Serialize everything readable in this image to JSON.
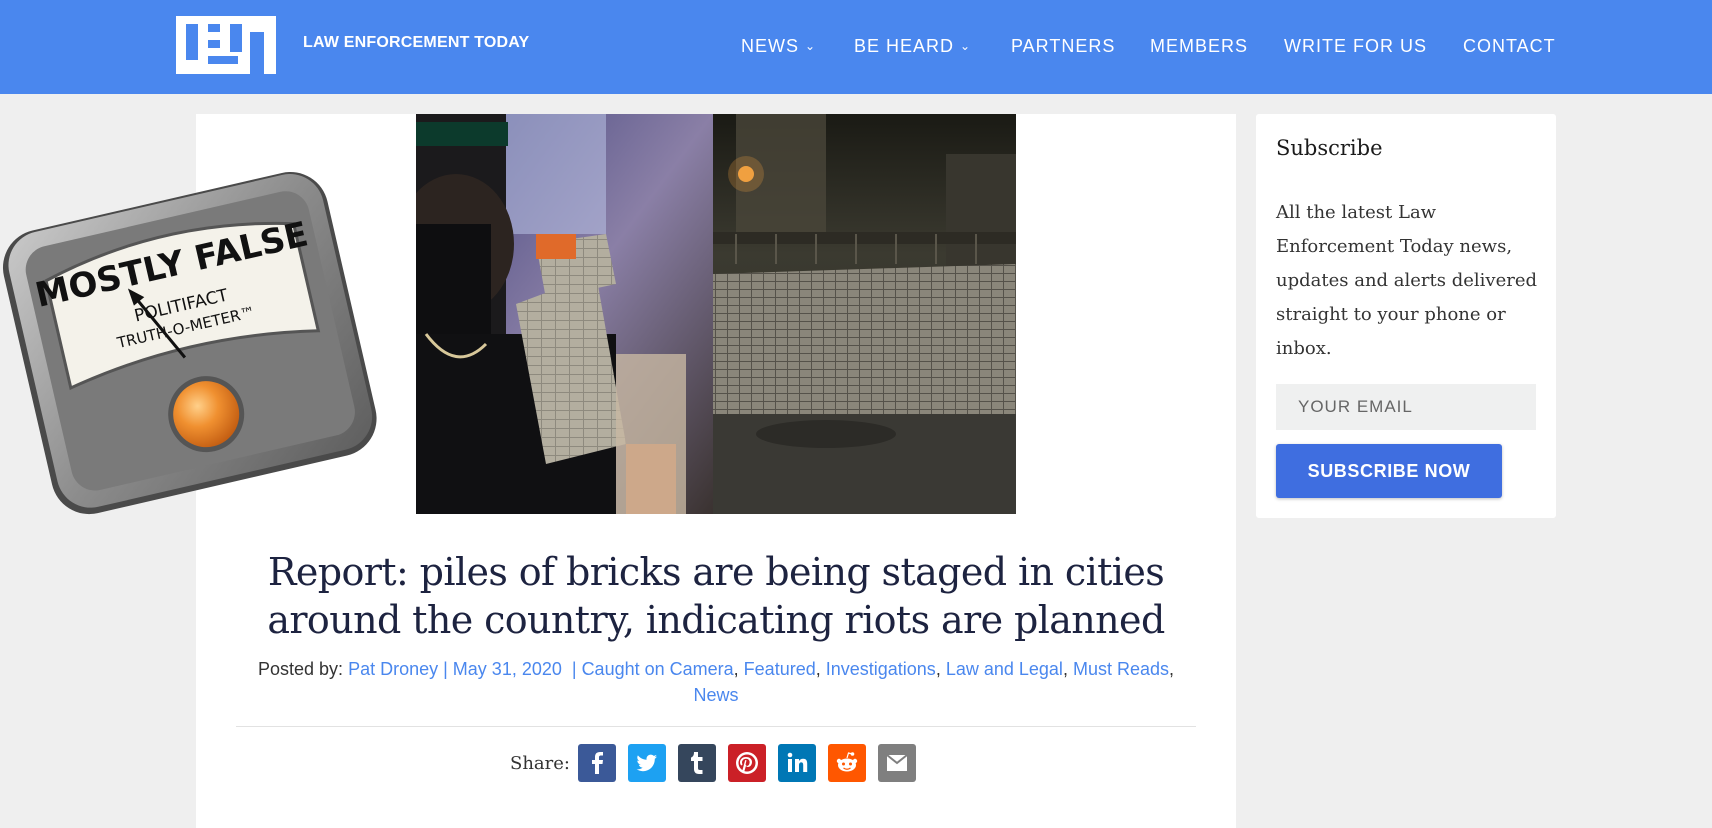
{
  "header": {
    "site_name": "LAW ENFORCEMENT TODAY",
    "logo_icon": "let-logo",
    "nav": [
      {
        "label": "NEWS",
        "has_dropdown": true
      },
      {
        "label": "BE HEARD",
        "has_dropdown": true
      },
      {
        "label": "PARTNERS",
        "has_dropdown": false
      },
      {
        "label": "MEMBERS",
        "has_dropdown": false
      },
      {
        "label": "WRITE FOR US",
        "has_dropdown": false
      },
      {
        "label": "CONTACT",
        "has_dropdown": false
      }
    ]
  },
  "rating": {
    "verdict": "MOSTLY FALSE",
    "brand_line1": "POLITIFACT",
    "brand_line2": "TRUTH-O-METER™"
  },
  "article": {
    "title": "Report: piles of bricks are being staged in cities around the country, indicating riots are planned",
    "posted_by_label": "Posted by:",
    "author": "Pat Droney",
    "date": "May 31, 2020",
    "categories": [
      "Caught on Camera",
      "Featured",
      "Investigations",
      "Law and Legal",
      "Must Reads",
      "News"
    ],
    "share_label": "Share:",
    "share_buttons": [
      {
        "name": "facebook",
        "color": "#3b5998"
      },
      {
        "name": "twitter",
        "color": "#1da1f2"
      },
      {
        "name": "tumblr",
        "color": "#35465c"
      },
      {
        "name": "pinterest",
        "color": "#cb2027"
      },
      {
        "name": "linkedin",
        "color": "#0077b5"
      },
      {
        "name": "reddit",
        "color": "#ff5700"
      },
      {
        "name": "email",
        "color": "#7f7f7f"
      }
    ]
  },
  "sidebar": {
    "title": "Subscribe",
    "description": "All the latest Law Enforcement Today news, updates and alerts delivered straight to your phone or inbox.",
    "email_placeholder": "YOUR EMAIL",
    "button_label": "SUBSCRIBE NOW"
  },
  "colors": {
    "header_bg": "#4a87ee",
    "link": "#4a87ee",
    "subscribe_button": "#3f6ee0",
    "headline": "#1d2340"
  }
}
